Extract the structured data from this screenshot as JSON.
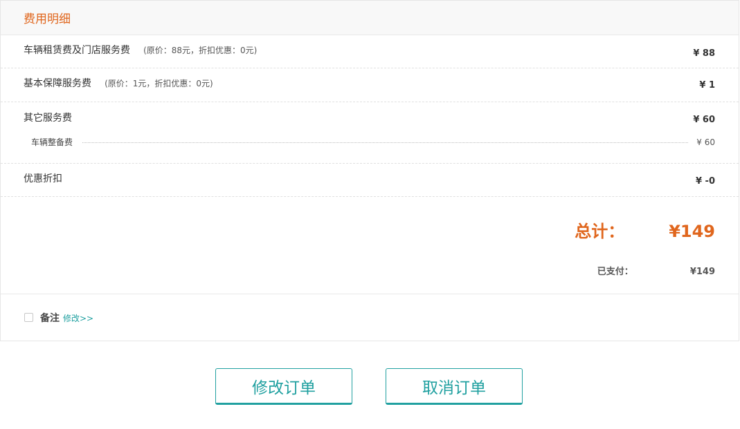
{
  "header": {
    "title": "费用明细"
  },
  "fees": {
    "rental": {
      "label": "车辆租赁费及门店服务费",
      "note": "(原价：88元，折扣优惠：0元)",
      "amount": "¥ 88"
    },
    "basic_protection": {
      "label": "基本保障服务费",
      "note": "(原价：1元，折扣优惠：0元)",
      "amount": "¥ 1"
    },
    "other": {
      "label": "其它服务费",
      "amount": "¥ 60",
      "sub_items": [
        {
          "label": "车辆整备费",
          "amount": "¥ 60"
        }
      ]
    },
    "discount": {
      "label": "优惠折扣",
      "amount": "¥ -0"
    }
  },
  "totals": {
    "total_label": "总计：",
    "total_amount": "¥149",
    "paid_label": "已支付：",
    "paid_amount": "¥149"
  },
  "remark": {
    "label": "备注",
    "edit_link": "修改>>"
  },
  "actions": {
    "modify_order": "修改订单",
    "cancel_order": "取消订单"
  },
  "colors": {
    "accent_orange": "#e0661d",
    "accent_teal": "#20a0a0"
  }
}
